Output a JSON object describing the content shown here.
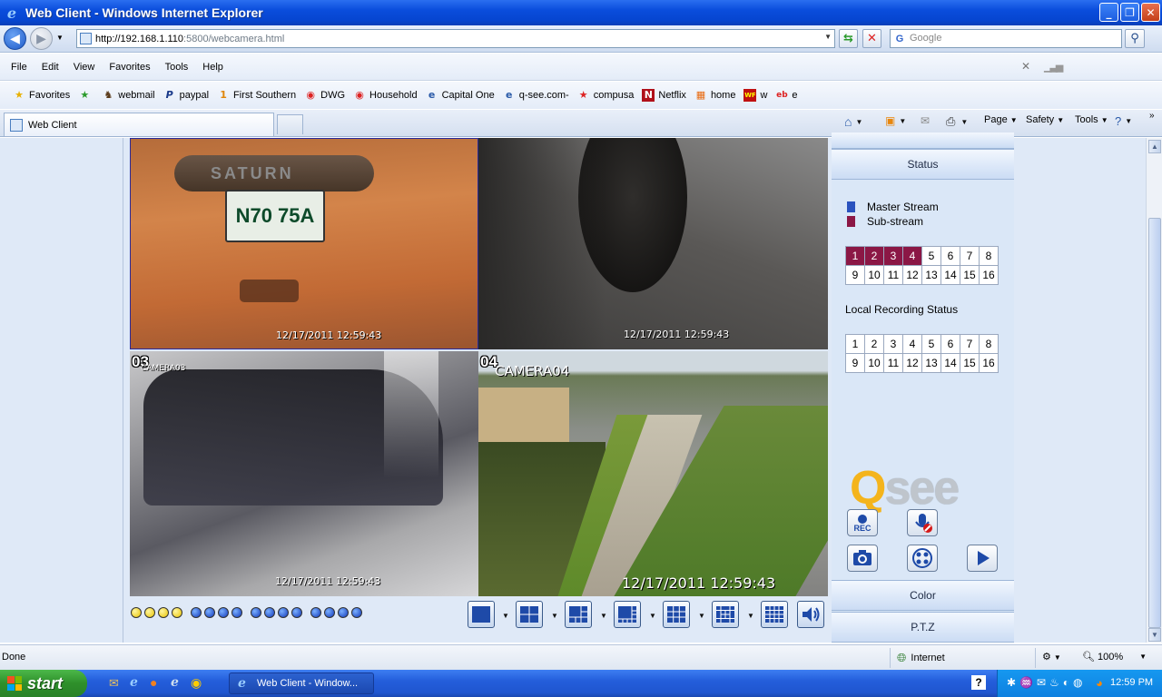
{
  "window": {
    "title": "Web Client - Windows Internet Explorer"
  },
  "nav": {
    "url_host": "http://192.168.1.110",
    "url_path": ":5800/webcamera.html",
    "search_placeholder": "Google"
  },
  "menu": [
    "File",
    "Edit",
    "View",
    "Favorites",
    "Tools",
    "Help"
  ],
  "favorites": {
    "label": "Favorites",
    "items": [
      "webmail",
      "paypal",
      "First Southern",
      "DWG",
      "Household",
      "Capital One",
      "q-see.com-",
      "compusa",
      "Netflix",
      "home",
      "w",
      "e"
    ]
  },
  "tab": {
    "label": "Web Client"
  },
  "commands": [
    "Page",
    "Safety",
    "Tools"
  ],
  "cameras": [
    {
      "number": "",
      "name": "",
      "timestamp": "12/17/2011 12:59:43",
      "plate": "N70 75A",
      "car_brand": "SATURN"
    },
    {
      "number": "",
      "name": "",
      "timestamp": "12/17/2011 12:59:43"
    },
    {
      "number": "03",
      "name": "CAMERA03",
      "timestamp": "12/17/2011 12:59:43"
    },
    {
      "number": "04",
      "name": "CAMERA04",
      "timestamp": "12/17/2011 12:59:43"
    }
  ],
  "panel": {
    "status_header": "Status",
    "legend": [
      {
        "label": "Master Stream",
        "color": "#2a52be"
      },
      {
        "label": "Sub-stream",
        "color": "#8b1745"
      }
    ],
    "channels_row1": [
      "1",
      "2",
      "3",
      "4",
      "5",
      "6",
      "7",
      "8"
    ],
    "channels_row2": [
      "9",
      "10",
      "11",
      "12",
      "13",
      "14",
      "15",
      "16"
    ],
    "active_channels": [
      "1",
      "2",
      "3",
      "4"
    ],
    "local_recording_label": "Local Recording Status",
    "rec_label": "REC",
    "color_header": "Color",
    "ptz_header": "P.T.Z",
    "logo": "Q·see"
  },
  "statusbar": {
    "left": "Done",
    "zone": "Internet",
    "zoom": "100%"
  },
  "taskbar": {
    "start": "start",
    "task": "Web Client - Window...",
    "clock": "12:59 PM"
  }
}
